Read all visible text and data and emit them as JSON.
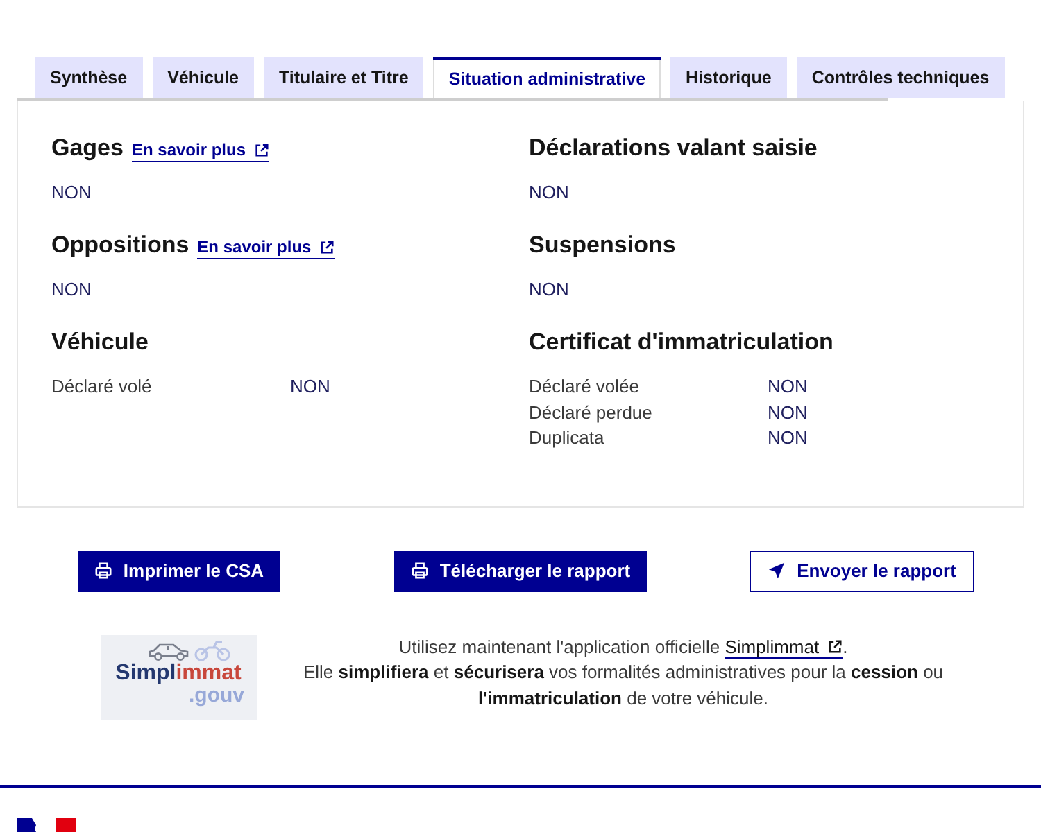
{
  "tabs": [
    {
      "label": "Synthèse",
      "selected": false
    },
    {
      "label": "Véhicule",
      "selected": false
    },
    {
      "label": "Titulaire et Titre",
      "selected": false
    },
    {
      "label": "Situation administrative",
      "selected": true
    },
    {
      "label": "Historique",
      "selected": false
    },
    {
      "label": "Contrôles techniques",
      "selected": false
    }
  ],
  "sections": [
    {
      "kind": "status",
      "title": "Gages",
      "link": "En savoir plus",
      "value": "NON"
    },
    {
      "kind": "status",
      "title": "Déclarations valant saisie",
      "value": "NON"
    },
    {
      "kind": "status",
      "title": "Oppositions",
      "link": "En savoir plus",
      "value": "NON"
    },
    {
      "kind": "status",
      "title": "Suspensions",
      "value": "NON"
    },
    {
      "kind": "table",
      "title": "Véhicule",
      "rows": [
        {
          "label": "Déclaré volé",
          "value": "NON"
        }
      ]
    },
    {
      "kind": "table",
      "title": "Certificat d'immatriculation",
      "rows": [
        {
          "label": "Déclaré volée",
          "value": "NON"
        },
        {
          "label": "Déclaré perdue",
          "value": "NON"
        },
        {
          "label": "Duplicata",
          "value": "NON"
        }
      ]
    }
  ],
  "actions": [
    {
      "label": "Imprimer le CSA",
      "kind": "primary"
    },
    {
      "label": "Télécharger le rapport",
      "kind": "primary"
    },
    {
      "label": "Envoyer le rapport",
      "kind": "secondary"
    }
  ],
  "promo": {
    "logo": {
      "wordmark_start": "Simpl",
      "wordmark_end": "immat",
      "suffix": ".gouv"
    },
    "text_before": "Utilisez maintenant l'application officielle ",
    "link": "Simplimmat",
    "text_after": ".",
    "text_2": "Elle **simplifiera** et **sécurisera** vos formalités administratives pour la **cession** ou **l'immatriculation** de votre véhicule."
  }
}
